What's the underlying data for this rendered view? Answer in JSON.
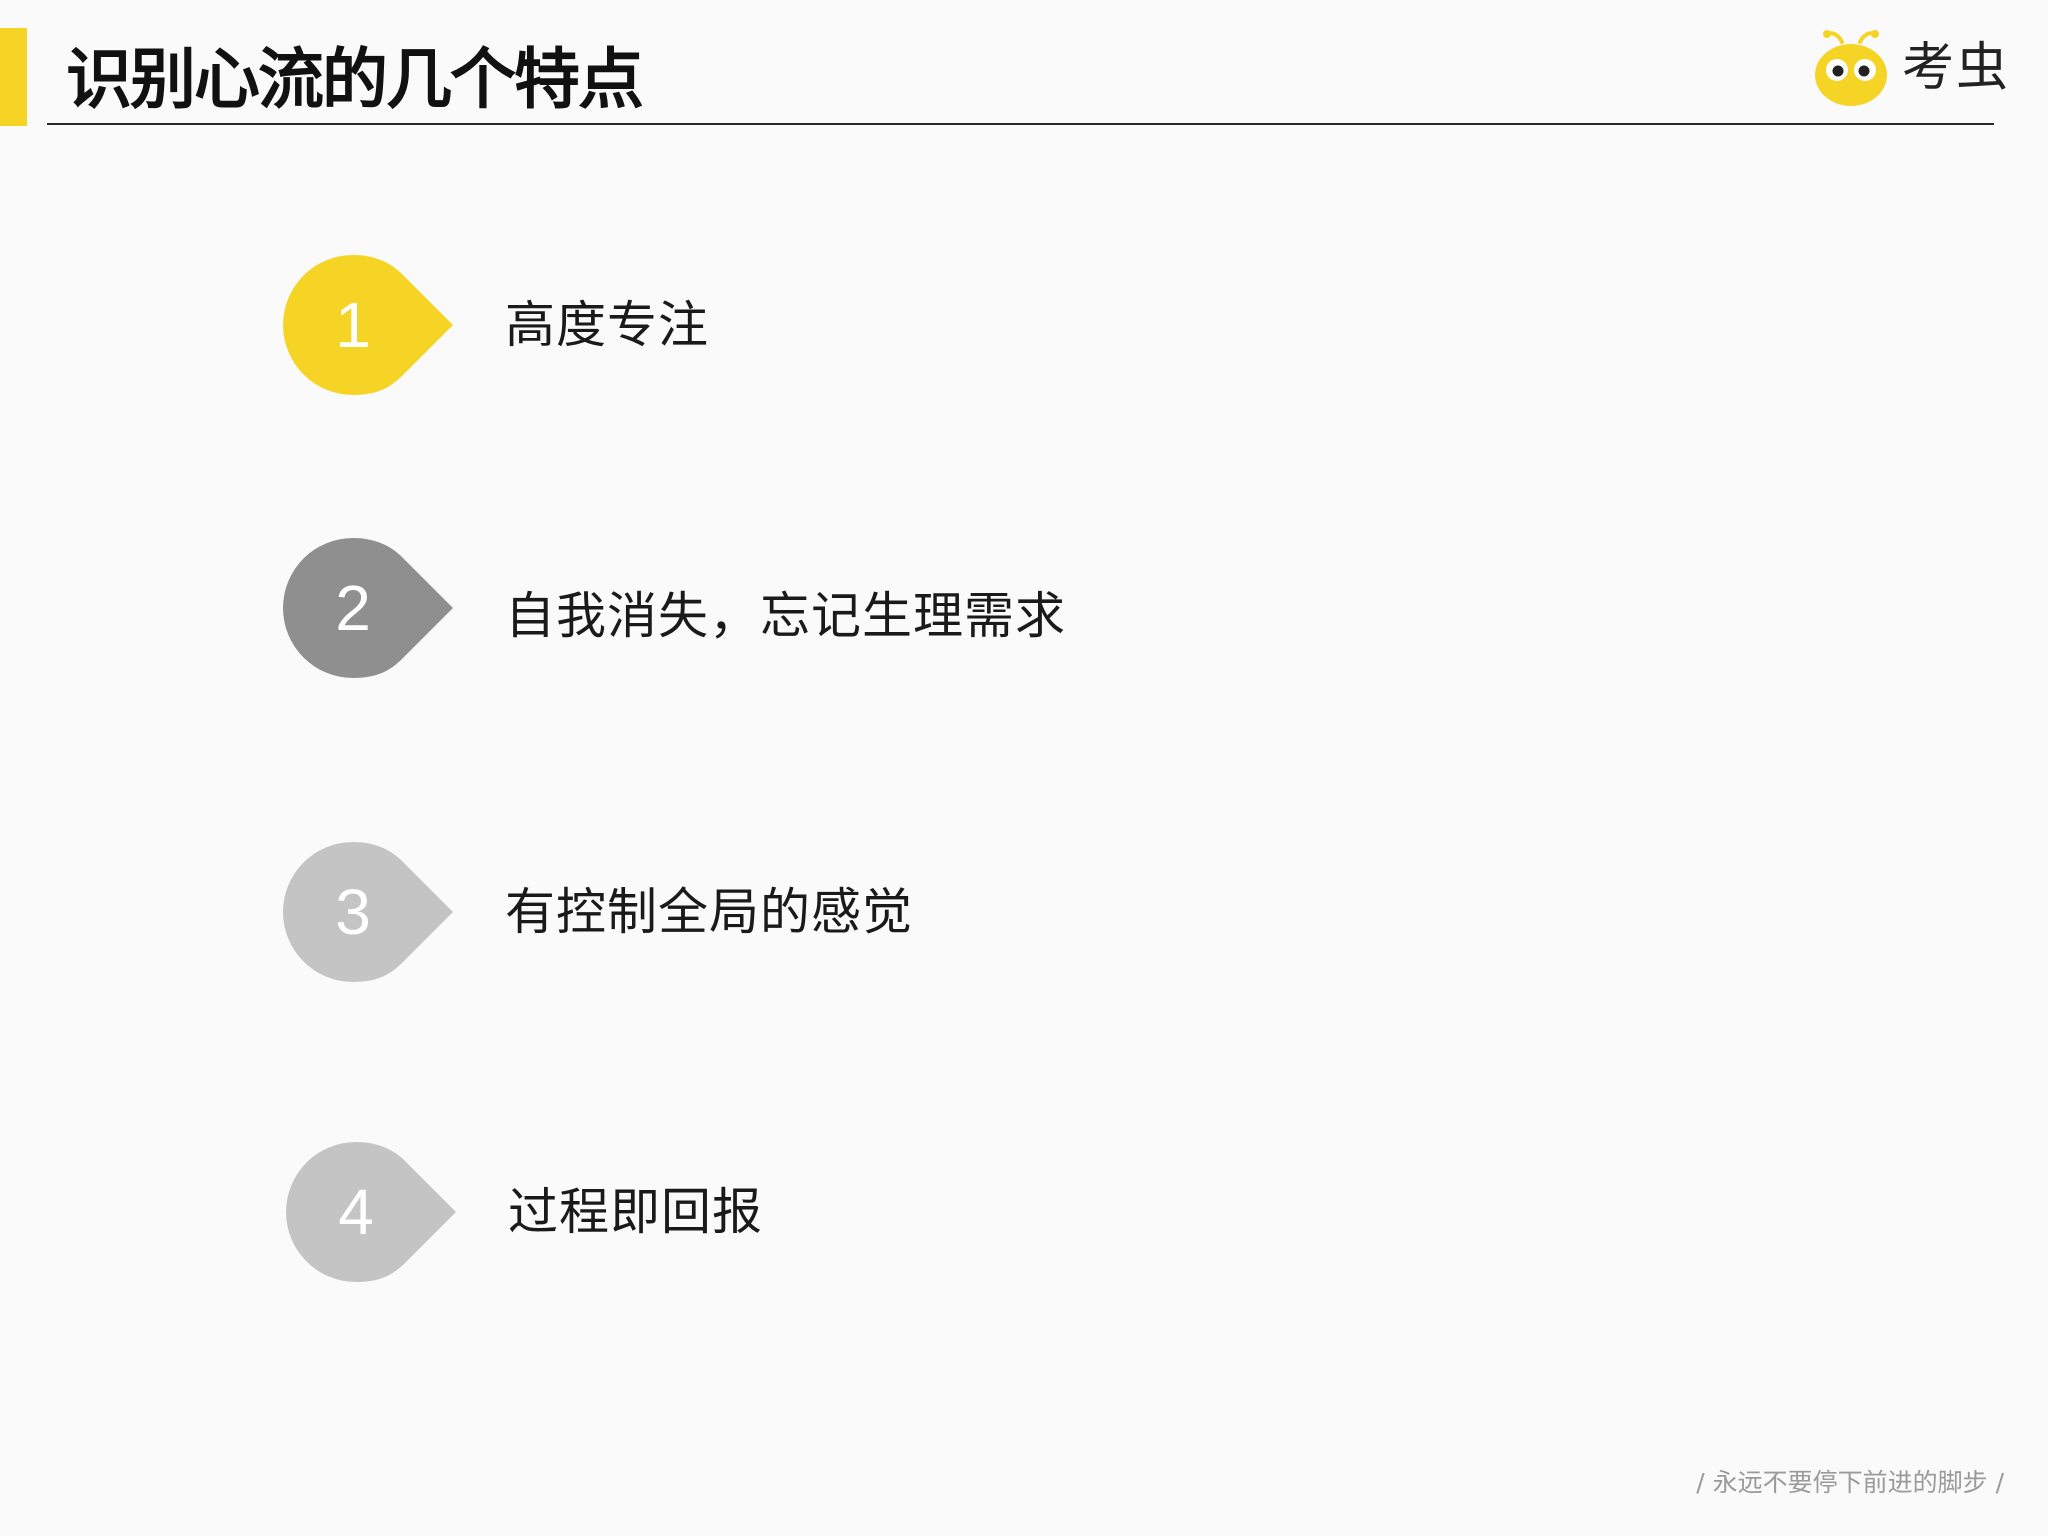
{
  "page": {
    "title": "识别心流的几个特点",
    "accent_color": "#f5d426"
  },
  "logo": {
    "text": "考虫",
    "icon": "bug-mascot-icon"
  },
  "steps": [
    {
      "number": "1",
      "label": "高度专注",
      "color": "#f5d426"
    },
    {
      "number": "2",
      "label": "自我消失，忘记生理需求",
      "color": "#8f8f8f"
    },
    {
      "number": "3",
      "label": "有控制全局的感觉",
      "color": "#c4c4c4"
    },
    {
      "number": "4",
      "label": "过程即回报",
      "color": "#c4c4c4"
    }
  ],
  "footer": {
    "slogan": "/ 永远不要停下前进的脚步 /"
  }
}
